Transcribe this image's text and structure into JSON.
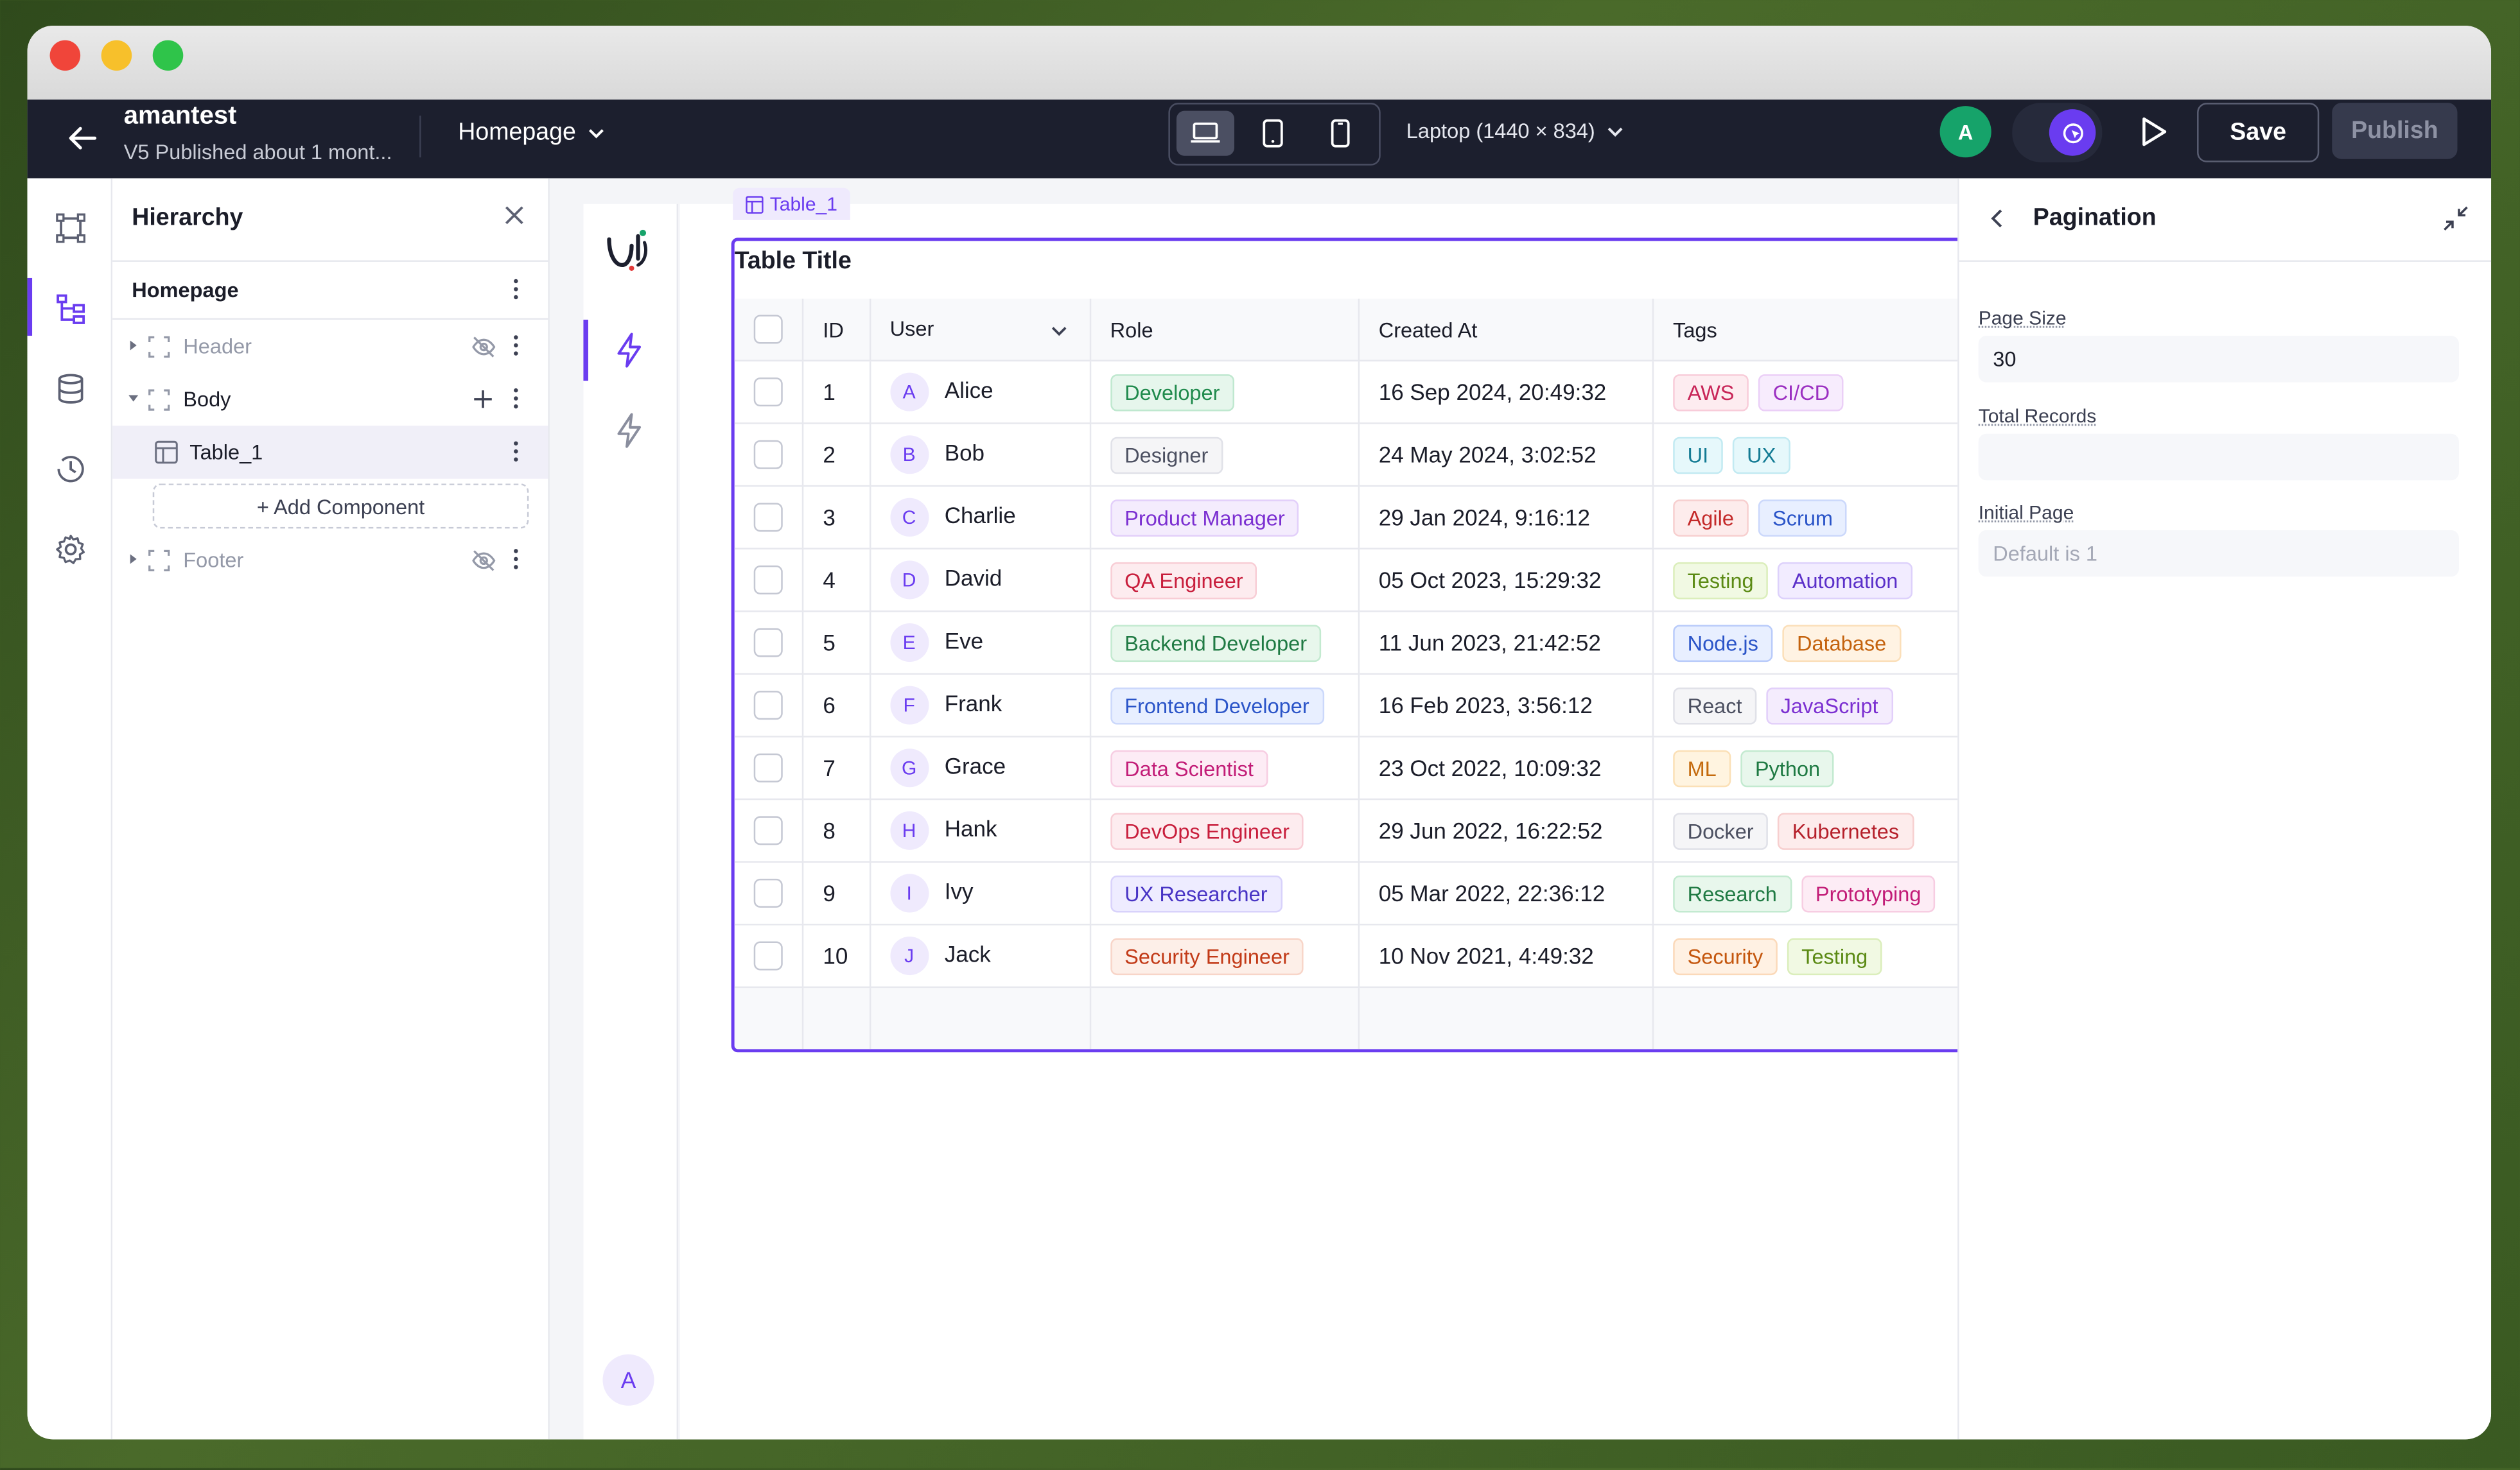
{
  "project": {
    "name": "amantest",
    "subtitle": "V5 Published about 1 mont..."
  },
  "page_select": "Homepage",
  "viewport": "Laptop (1440 × 834)",
  "user_avatar": "A",
  "buttons": {
    "save": "Save",
    "publish": "Publish"
  },
  "hierarchy": {
    "title": "Hierarchy",
    "root": "Homepage",
    "items": [
      {
        "label": "Header",
        "hidden": true
      },
      {
        "label": "Body"
      },
      {
        "label": "Table_1"
      },
      {
        "label": "Footer",
        "hidden": true
      }
    ],
    "add_component": "+ Add Component"
  },
  "component_tag": "Table_1",
  "table": {
    "title": "Table Title",
    "columns": [
      "ID",
      "User",
      "Role",
      "Created At",
      "Tags"
    ],
    "rows": [
      {
        "id": "1",
        "initial": "A",
        "user": "Alice",
        "role": "Developer",
        "created": "16 Sep 2024, 20:49:32",
        "tags": [
          "AWS",
          "CI/CD"
        ]
      },
      {
        "id": "2",
        "initial": "B",
        "user": "Bob",
        "role": "Designer",
        "created": "24 May 2024, 3:02:52",
        "tags": [
          "UI",
          "UX"
        ]
      },
      {
        "id": "3",
        "initial": "C",
        "user": "Charlie",
        "role": "Product Manager",
        "created": "29 Jan 2024, 9:16:12",
        "tags": [
          "Agile",
          "Scrum"
        ]
      },
      {
        "id": "4",
        "initial": "D",
        "user": "David",
        "role": "QA Engineer",
        "created": "05 Oct 2023, 15:29:32",
        "tags": [
          "Testing",
          "Automation"
        ]
      },
      {
        "id": "5",
        "initial": "E",
        "user": "Eve",
        "role": "Backend Developer",
        "created": "11 Jun 2023, 21:42:52",
        "tags": [
          "Node.js",
          "Database"
        ]
      },
      {
        "id": "6",
        "initial": "F",
        "user": "Frank",
        "role": "Frontend Developer",
        "created": "16 Feb 2023, 3:56:12",
        "tags": [
          "React",
          "JavaScript"
        ]
      },
      {
        "id": "7",
        "initial": "G",
        "user": "Grace",
        "role": "Data Scientist",
        "created": "23 Oct 2022, 10:09:32",
        "tags": [
          "ML",
          "Python"
        ]
      },
      {
        "id": "8",
        "initial": "H",
        "user": "Hank",
        "role": "DevOps Engineer",
        "created": "29 Jun 2022, 16:22:52",
        "tags": [
          "Docker",
          "Kubernetes"
        ]
      },
      {
        "id": "9",
        "initial": "I",
        "user": "Ivy",
        "role": "UX Researcher",
        "created": "05 Mar 2022, 22:36:12",
        "tags": [
          "Research",
          "Prototyping"
        ]
      },
      {
        "id": "10",
        "initial": "J",
        "user": "Jack",
        "role": "Security Engineer",
        "created": "10 Nov 2021, 4:49:32",
        "tags": [
          "Security",
          "Testing"
        ]
      }
    ]
  },
  "inner_avatar": "A",
  "pagination": {
    "title": "Pagination",
    "page_size_label": "Page Size",
    "page_size_value": "30",
    "total_records_label": "Total Records",
    "total_records_value": "",
    "initial_page_label": "Initial Page",
    "initial_page_placeholder": "Default is 1"
  },
  "colors": {
    "accent": "#6a3cf0",
    "topbar": "#1c1f2e",
    "avatar_green": "#16a36a"
  },
  "chip_colors": {
    "Developer": [
      "#e6f6ec",
      "#1f8a4c",
      "#bfe8cf"
    ],
    "Designer": [
      "#f5f5f7",
      "#4b4f60",
      "#e0e1e8"
    ],
    "Product Manager": [
      "#f4ecfd",
      "#7b2fd1",
      "#e2cffa"
    ],
    "QA Engineer": [
      "#fdecef",
      "#c81e3c",
      "#f8cdd5"
    ],
    "Backend Developer": [
      "#e8f7ec",
      "#1f7a43",
      "#c3ead0"
    ],
    "Frontend Developer": [
      "#e8efff",
      "#2a54c8",
      "#cbd8fb"
    ],
    "Data Scientist": [
      "#fdecf5",
      "#c21c77",
      "#f7cde2"
    ],
    "DevOps Engineer": [
      "#fdecef",
      "#c81e3c",
      "#f8cdd5"
    ],
    "UX Researcher": [
      "#eeecff",
      "#4733c4",
      "#d8d2fb"
    ],
    "Security Engineer": [
      "#fdefe8",
      "#c23a17",
      "#f8d5c8"
    ],
    "AWS": [
      "#fdecf0",
      "#c82558",
      "#f8ccd9"
    ],
    "CI/CD": [
      "#f7ecfd",
      "#9b2fc1",
      "#ebcff7"
    ],
    "UI": [
      "#e6f8fb",
      "#137b94",
      "#c2eaf2"
    ],
    "UX": [
      "#e6f8fb",
      "#137b94",
      "#c2eaf2"
    ],
    "Agile": [
      "#fdecec",
      "#c42a2a",
      "#f7cfcf"
    ],
    "Scrum": [
      "#e8efff",
      "#2a54c8",
      "#cbd8fb"
    ],
    "Testing": [
      "#f1f9e3",
      "#5b8a14",
      "#dbeebb"
    ],
    "Automation": [
      "#f2ecff",
      "#5b30c9",
      "#ddd1fb"
    ],
    "Node.js": [
      "#e8efff",
      "#2a54c8",
      "#b9cbfa"
    ],
    "Database": [
      "#fff3e3",
      "#c4620d",
      "#fbdfb9"
    ],
    "React": [
      "#f5f5f7",
      "#4b4f60",
      "#e0e1e8"
    ],
    "JavaScript": [
      "#f4ecfd",
      "#7b2fd1",
      "#e2cffa"
    ],
    "ML": [
      "#fff4e0",
      "#c46a0d",
      "#fbe0b6"
    ],
    "Python": [
      "#e8f7ec",
      "#1f7a43",
      "#c3ead0"
    ],
    "Docker": [
      "#f5f5f7",
      "#4b4f60",
      "#e0e1e8"
    ],
    "Kubernetes": [
      "#fdecec",
      "#b51f2a",
      "#f7cfcf"
    ],
    "Research": [
      "#e8f7ec",
      "#1f7a43",
      "#c3ead0"
    ],
    "Prototyping": [
      "#fdecf5",
      "#c21c77",
      "#f7cde2"
    ],
    "Security": [
      "#fff1e3",
      "#c4560d",
      "#fbd9b9"
    ]
  }
}
